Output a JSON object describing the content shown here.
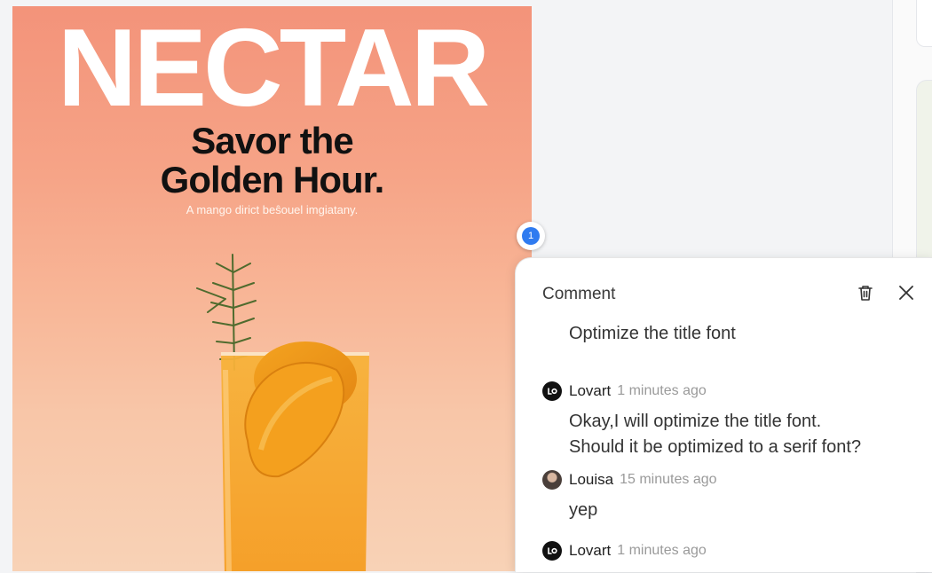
{
  "poster": {
    "title": "NECTAR",
    "subtitle": "Savor the\nGolden Hour.",
    "tagline": "A mango dirict beŝouel imgiatany."
  },
  "pin": {
    "number": "1"
  },
  "comment_panel": {
    "title": "Comment",
    "delete_icon": "trash-icon",
    "close_icon": "close-icon",
    "first_message": "Optimize the title font",
    "replies": [
      {
        "author": "Lovart",
        "time": "1 minutes ago",
        "text": "Okay,I will optimize the title font.\nShould it be optimized to a serif font?",
        "avatar": "lovart-logo-icon"
      },
      {
        "author": "Louisa",
        "time": "15 minutes ago",
        "text": "yep",
        "avatar": "user-photo"
      },
      {
        "author": "Lovart",
        "time": "1 minutes ago",
        "text": "",
        "avatar": "lovart-logo-icon"
      }
    ]
  },
  "colors": {
    "pin": "#2f7bf0",
    "poster_top": "#f3937a",
    "poster_bottom": "#f8d2b6"
  }
}
